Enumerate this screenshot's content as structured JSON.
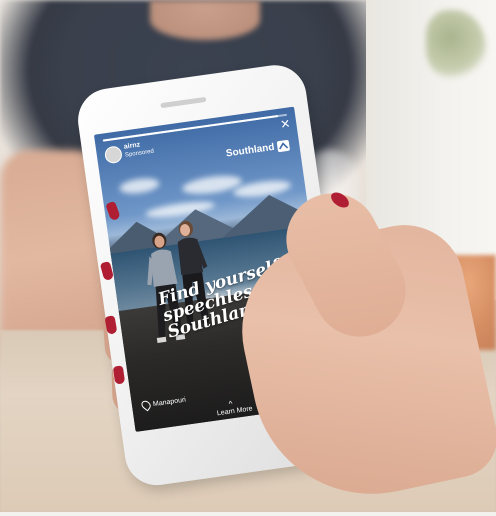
{
  "story": {
    "account_name": "airnz",
    "sponsored_label": "Sponsored",
    "close_icon": "close-icon",
    "brand": "Southland",
    "brand_icon": "southland-mark-icon",
    "headline_lines": [
      "Find yourself",
      "speechless in",
      "Southland"
    ],
    "location": "Manapouri",
    "location_icon": "map-pin-icon",
    "cta_label": "Learn More",
    "cta_icon": "chevron-up-icon",
    "share_icon": "send-icon",
    "more_icon": "more-icon",
    "progress_fraction": 0.95
  },
  "colors": {
    "nail_polish": "#b01e33",
    "phone_body": "#f3f3f3",
    "sky": "#6f97c8"
  }
}
